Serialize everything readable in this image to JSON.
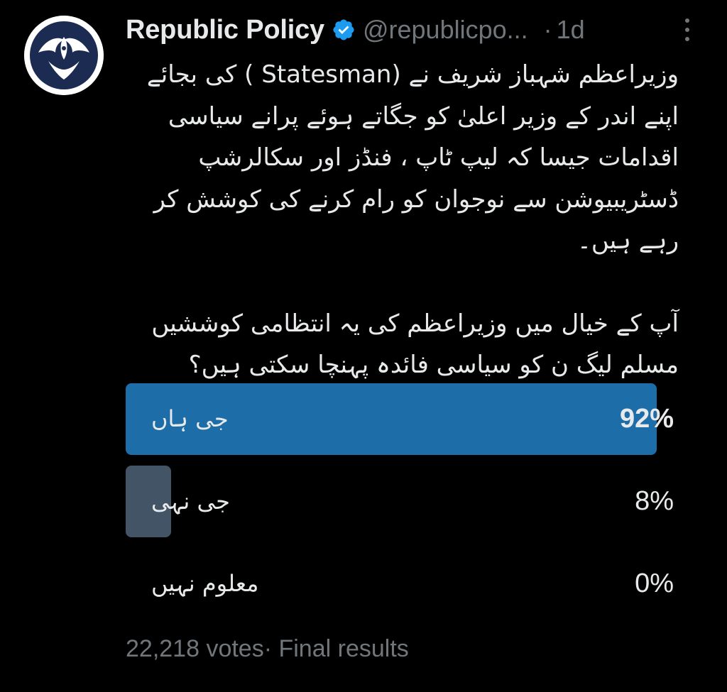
{
  "tweet": {
    "display_name": "Republic Policy",
    "handle": "@republicpo...",
    "separator": "·",
    "time": "1d",
    "verified_icon": "verified-badge-icon",
    "more_icon": "more-vertical-icon",
    "avatar_icon": "phoenix-logo",
    "body": {
      "paragraph1": "وزیراعظم شہباز شریف نے (Statesman ) کی بجائے اپنے اندر کے وزیر اعلیٰ کو جگاتے ہوئے پرانے سیاسی اقدامات جیسا کہ لیپ ٹاپ ، فنڈز اور سکالرشپ ڈسٹریبیوشن سے نوجوان کو رام کرنے کی کوشش کر رہے ہیں۔",
      "paragraph2": "آپ کے خیال میں وزیراعظم کی یہ انتظامی کوششیں مسلم لیگ ن کو سیاسی فائدہ پہنچا سکتی ہیں؟"
    }
  },
  "poll": {
    "options": [
      {
        "label": "جی ہاں",
        "percent": "92%",
        "fraction": 0.92,
        "leader": true
      },
      {
        "label": "جی نہی",
        "percent": "8%",
        "fraction": 0.08,
        "leader": false
      },
      {
        "label": "معلوم نہیں",
        "percent": "0%",
        "fraction": 0.0,
        "leader": false
      }
    ],
    "votes": "22,218 votes",
    "status_sep": "·",
    "status": "Final results"
  },
  "colors": {
    "background": "#000000",
    "text": "#e7e9ea",
    "muted": "#71767b",
    "leader_fill": "#1d6ea8",
    "other_fill": "#435466",
    "verified": "#1d9bf0"
  }
}
